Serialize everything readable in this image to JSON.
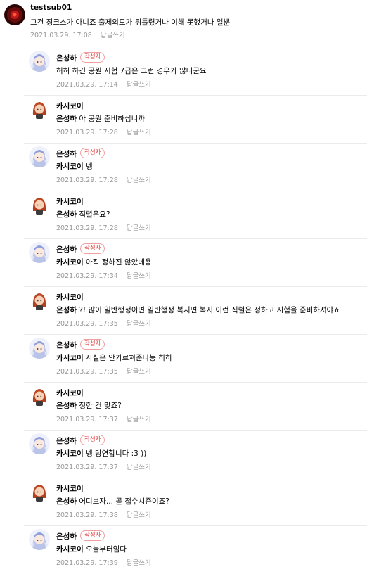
{
  "top_comment": {
    "nickname": "testsub01",
    "text": "그건 징크스가 아니죠 출제의도가 뒤틀렸거나 이해 못했거나 일뿐",
    "date": "2021.03.29. 17:08",
    "reply_label": "답글쓰기"
  },
  "writer_badge": "작성자",
  "replies": [
    {
      "nickname": "은성하",
      "writer": true,
      "mention": "",
      "text": "허허 하긴 공뭔 시험 7급은 그런 경우가 많더군요",
      "date": "2021.03.29. 17:14",
      "reply_label": "답글쓰기"
    },
    {
      "nickname": "카시코이",
      "writer": false,
      "mention": "은성하",
      "text": "아 공뭔 준비하십니까",
      "date": "2021.03.29. 17:28",
      "reply_label": "답글쓰기"
    },
    {
      "nickname": "은성하",
      "writer": true,
      "mention": "카시코이",
      "text": "넹",
      "date": "2021.03.29. 17:28",
      "reply_label": "답글쓰기"
    },
    {
      "nickname": "카시코이",
      "writer": false,
      "mention": "은성하",
      "text": "직렬은요?",
      "date": "2021.03.29. 17:28",
      "reply_label": "답글쓰기"
    },
    {
      "nickname": "은성하",
      "writer": true,
      "mention": "카시코이",
      "text": "아직 정하진 않았네용",
      "date": "2021.03.29. 17:34",
      "reply_label": "답글쓰기"
    },
    {
      "nickname": "카시코이",
      "writer": false,
      "mention": "은성하",
      "text": "?! 않이 일반행정이면 일반행정 복지면 복지 이런 직렬은 정하고 시험을 준비하셔야죠",
      "date": "2021.03.29. 17:35",
      "reply_label": "답글쓰기"
    },
    {
      "nickname": "은성하",
      "writer": true,
      "mention": "카시코이",
      "text": "사실은 안가르쳐준다능 히히",
      "date": "2021.03.29. 17:35",
      "reply_label": "답글쓰기"
    },
    {
      "nickname": "카시코이",
      "writer": false,
      "mention": "은성하",
      "text": "정한 건 맞죠?",
      "date": "2021.03.29. 17:37",
      "reply_label": "답글쓰기"
    },
    {
      "nickname": "은성하",
      "writer": true,
      "mention": "카시코이",
      "text": "넹 당연합니다 :3 ))",
      "date": "2021.03.29. 17:37",
      "reply_label": "답글쓰기"
    },
    {
      "nickname": "카시코이",
      "writer": false,
      "mention": "은성하",
      "text": "어디보자... 곧 접수시즌이죠?",
      "date": "2021.03.29. 17:38",
      "reply_label": "답글쓰기"
    },
    {
      "nickname": "은성하",
      "writer": true,
      "mention": "카시코이",
      "text": "오늘부터임다",
      "date": "2021.03.29. 17:39",
      "reply_label": "답글쓰기"
    }
  ],
  "colors": {
    "badge_red": "#e04a4a",
    "meta_gray": "#979797",
    "separator": "#ebebeb"
  }
}
